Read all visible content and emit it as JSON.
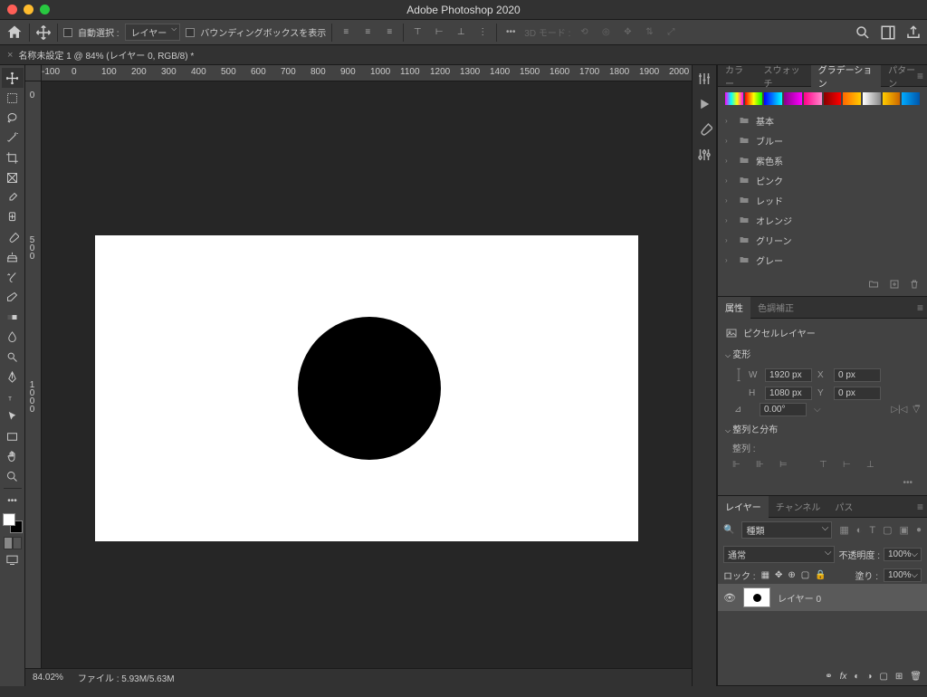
{
  "app_title": "Adobe Photoshop 2020",
  "options_bar": {
    "auto_select_label": "自動選択 :",
    "target_dropdown": "レイヤー",
    "transform_controls": "バウンディングボックスを表示",
    "mode_3d": "3D モード :"
  },
  "document_tab": "名称未設定 1 @ 84% (レイヤー 0, RGB/8) *",
  "ruler_h": [
    "-100",
    "0",
    "100",
    "200",
    "300",
    "400",
    "500",
    "600",
    "700",
    "800",
    "900",
    "1000",
    "1100",
    "1200",
    "1300",
    "1400",
    "1500",
    "1600",
    "1700",
    "1800",
    "1900",
    "2000"
  ],
  "ruler_v": [
    "0",
    "500",
    "1000"
  ],
  "status": {
    "zoom": "84.02%",
    "file_label": "ファイル :",
    "file_size": "5.93M/5.63M"
  },
  "gradient_panel": {
    "tabs": [
      "カラー",
      "スウォッチ",
      "グラデーション",
      "パターン"
    ],
    "folders": [
      "基本",
      "ブルー",
      "紫色系",
      "ピンク",
      "レッド",
      "オレンジ",
      "グリーン",
      "グレー"
    ]
  },
  "properties_panel": {
    "tabs": [
      "属性",
      "色調補正"
    ],
    "layer_type": "ピクセルレイヤー",
    "transform_section": "変形",
    "W": "1920 px",
    "H": "1080 px",
    "X": "0 px",
    "Y": "0 px",
    "angle": "0.00°",
    "align_section": "整列と分布",
    "align_label": "整列 :"
  },
  "layers_panel": {
    "tabs": [
      "レイヤー",
      "チャンネル",
      "パス"
    ],
    "filter": "種類",
    "blend": "通常",
    "opacity_label": "不透明度 :",
    "opacity": "100%",
    "lock_label": "ロック :",
    "fill_label": "塗り :",
    "fill": "100%",
    "layer_name": "レイヤー 0"
  }
}
